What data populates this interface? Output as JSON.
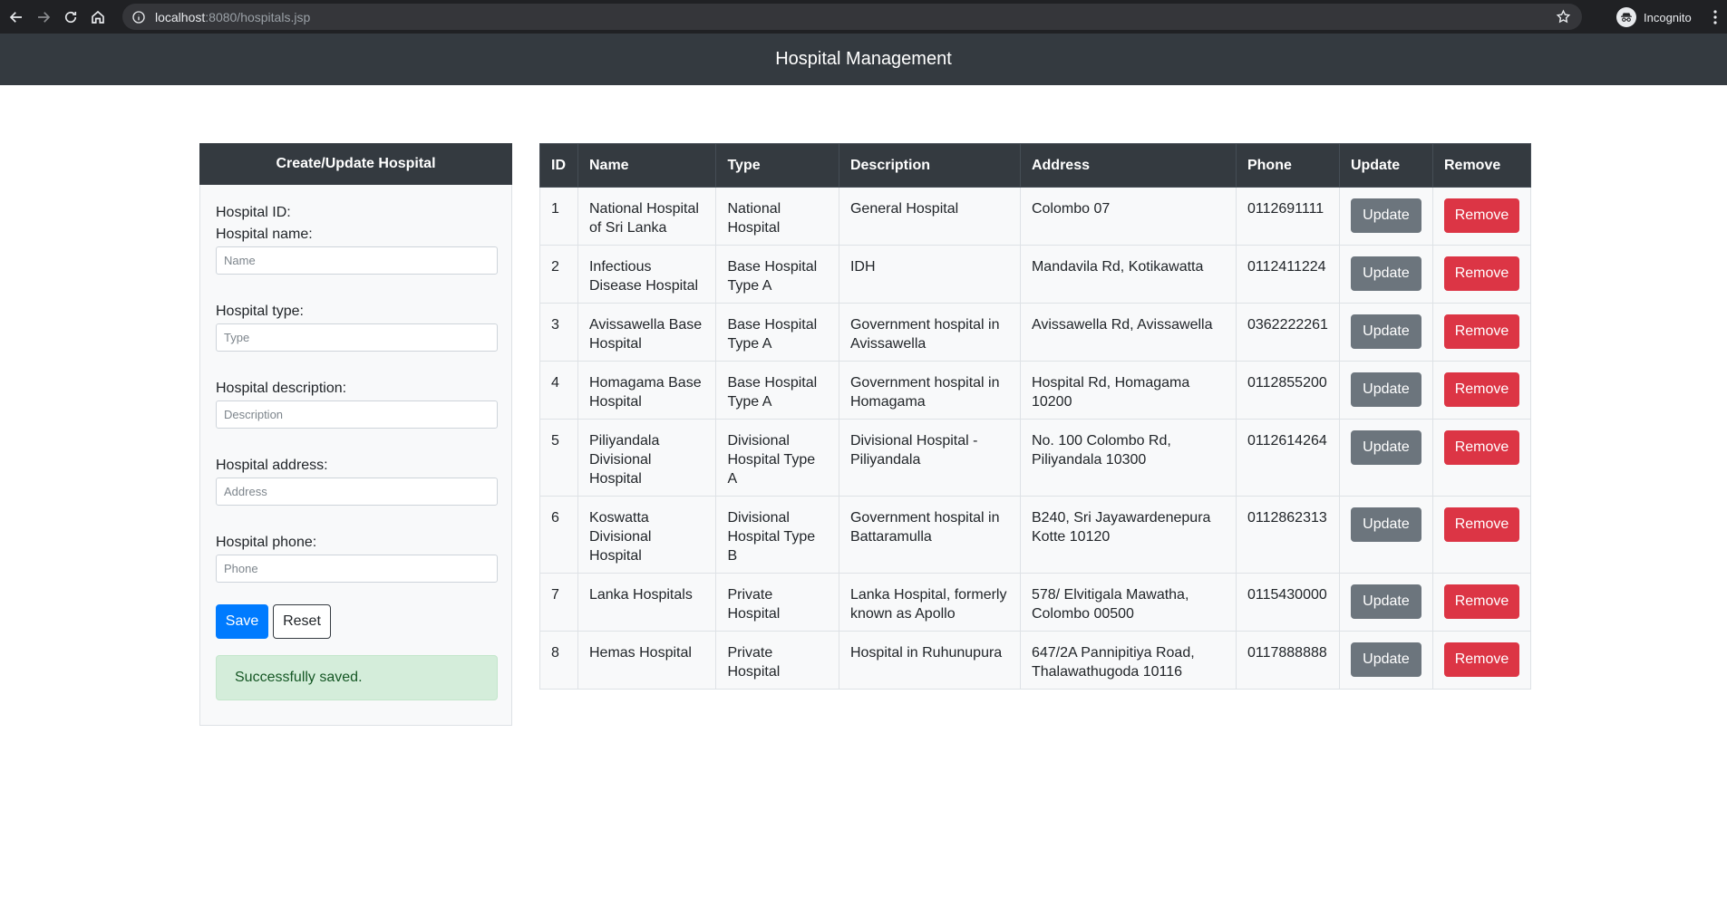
{
  "browser": {
    "url_host": "localhost",
    "url_rest": ":8080/hospitals.jsp",
    "profile_label": "Incognito"
  },
  "header": {
    "title": "Hospital Management"
  },
  "form": {
    "title": "Create/Update Hospital",
    "id_label": "Hospital ID:",
    "name_label": "Hospital name:",
    "name_placeholder": "Name",
    "type_label": "Hospital type:",
    "type_placeholder": "Type",
    "description_label": "Hospital description:",
    "description_placeholder": "Description",
    "address_label": "Hospital address:",
    "address_placeholder": "Address",
    "phone_label": "Hospital phone:",
    "phone_placeholder": "Phone",
    "save_label": "Save",
    "reset_label": "Reset",
    "success_message": "Successfully saved."
  },
  "table": {
    "columns": [
      "ID",
      "Name",
      "Type",
      "Description",
      "Address",
      "Phone",
      "Update",
      "Remove"
    ],
    "update_label": "Update",
    "remove_label": "Remove",
    "rows": [
      {
        "id": "1",
        "name": "National Hospital of Sri Lanka",
        "type": "National Hospital",
        "description": "General Hospital",
        "address": "Colombo 07",
        "phone": "0112691111"
      },
      {
        "id": "2",
        "name": "Infectious Disease Hospital",
        "type": "Base Hospital Type A",
        "description": "IDH",
        "address": "Mandavila Rd, Kotikawatta",
        "phone": "0112411224"
      },
      {
        "id": "3",
        "name": "Avissawella Base Hospital",
        "type": "Base Hospital Type A",
        "description": "Government hospital in Avissawella",
        "address": "Avissawella Rd, Avissawella",
        "phone": "0362222261"
      },
      {
        "id": "4",
        "name": "Homagama Base Hospital",
        "type": "Base Hospital Type A",
        "description": "Government hospital in Homagama",
        "address": "Hospital Rd, Homagama 10200",
        "phone": "0112855200"
      },
      {
        "id": "5",
        "name": "Piliyandala Divisional Hospital",
        "type": "Divisional Hospital Type A",
        "description": "Divisional Hospital - Piliyandala",
        "address": "No. 100 Colombo Rd, Piliyandala 10300",
        "phone": "0112614264"
      },
      {
        "id": "6",
        "name": "Koswatta Divisional Hospital",
        "type": "Divisional Hospital Type B",
        "description": "Government hospital in Battaramulla",
        "address": "B240, Sri Jayawardenepura Kotte 10120",
        "phone": "0112862313"
      },
      {
        "id": "7",
        "name": "Lanka Hospitals",
        "type": "Private Hospital",
        "description": "Lanka Hospital, formerly known as Apollo",
        "address": "578/ Elvitigala Mawatha, Colombo 00500",
        "phone": "0115430000"
      },
      {
        "id": "8",
        "name": "Hemas Hospital",
        "type": "Private Hospital",
        "description": "Hospital in Ruhunupura",
        "address": "647/2A Pannipitiya Road, Thalawathugoda 10116",
        "phone": "0117888888"
      }
    ]
  }
}
